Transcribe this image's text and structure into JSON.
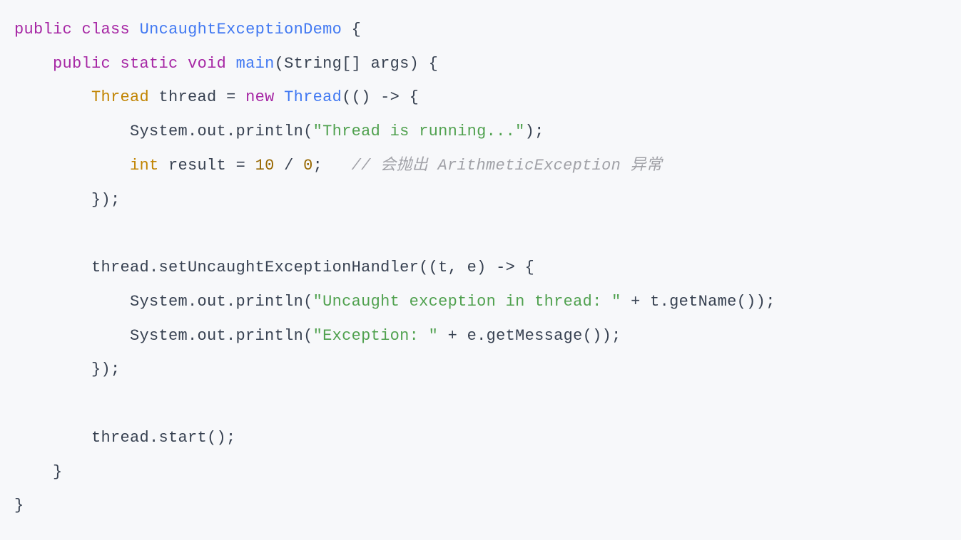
{
  "code": {
    "line1": {
      "kw_public": "public",
      "kw_class": "class",
      "class_name": "UncaughtExceptionDemo",
      "brace": " {"
    },
    "line2": {
      "indent": "    ",
      "kw_public": "public",
      "kw_static": "static",
      "kw_void": "void",
      "method": "main",
      "params": "(String[] args) {"
    },
    "line3": {
      "indent": "        ",
      "type": "Thread",
      "var": " thread = ",
      "kw_new": "new",
      "ctor": " Thread",
      "rest": "(() -> {"
    },
    "line4": {
      "indent": "            ",
      "call": "System.out.println(",
      "str": "\"Thread is running...\"",
      "end": ");"
    },
    "line5": {
      "indent": "            ",
      "type": "int",
      "var": " result = ",
      "num1": "10",
      "op": " / ",
      "num2": "0",
      "semi": ";   ",
      "comment": "// 会抛出 ArithmeticException 异常"
    },
    "line6": {
      "indent": "        ",
      "text": "});"
    },
    "line7": "",
    "line8": {
      "indent": "        ",
      "text": "thread.setUncaughtExceptionHandler((t, e) -> {"
    },
    "line9": {
      "indent": "            ",
      "call": "System.out.println(",
      "str": "\"Uncaught exception in thread: \"",
      "rest": " + t.getName());"
    },
    "line10": {
      "indent": "            ",
      "call": "System.out.println(",
      "str": "\"Exception: \"",
      "rest": " + e.getMessage());"
    },
    "line11": {
      "indent": "        ",
      "text": "});"
    },
    "line12": "",
    "line13": {
      "indent": "        ",
      "text": "thread.start();"
    },
    "line14": {
      "indent": "    ",
      "text": "}"
    },
    "line15": {
      "text": "}"
    }
  }
}
